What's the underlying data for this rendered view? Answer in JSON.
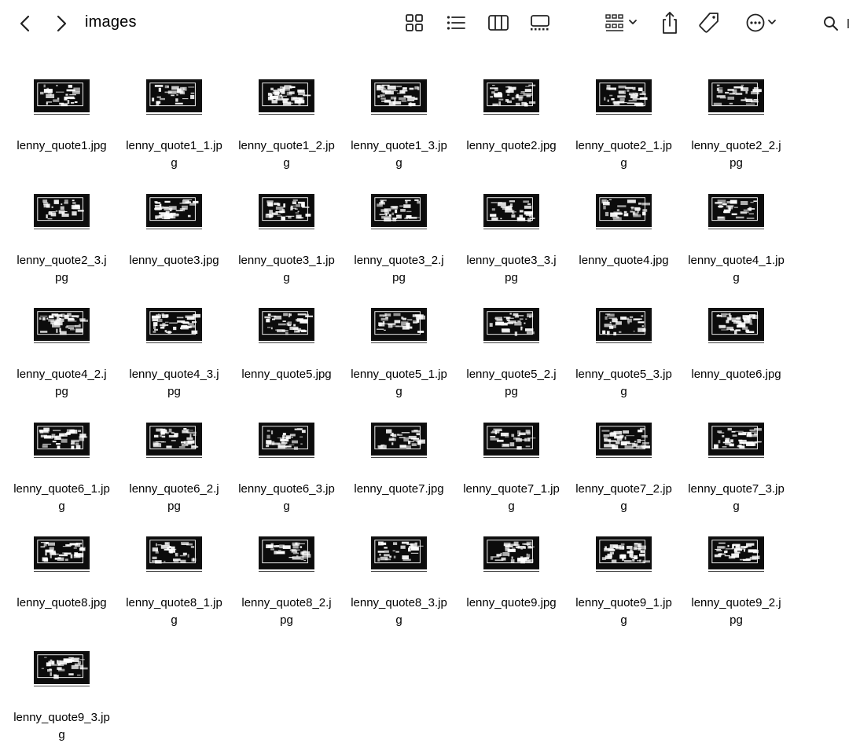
{
  "window": {
    "title": "images"
  },
  "toolbar": {
    "back_icon": "chevron-left-icon",
    "forward_icon": "chevron-right-icon",
    "view_modes": [
      "icon-view-icon",
      "list-view-icon",
      "column-view-icon",
      "gallery-view-icon"
    ],
    "group_icon": "group-by-icon",
    "share_icon": "share-icon",
    "tag_icon": "tag-icon",
    "action_icon": "more-actions-icon",
    "search_icon": "search-icon"
  },
  "files": [
    {
      "line1": "lenny_quote1.jpg",
      "line2": ""
    },
    {
      "line1": "lenny_quote1_1.jp",
      "line2": "g"
    },
    {
      "line1": "lenny_quote1_2.jp",
      "line2": "g"
    },
    {
      "line1": "lenny_quote1_3.jp",
      "line2": "g"
    },
    {
      "line1": "lenny_quote2.jpg",
      "line2": ""
    },
    {
      "line1": "lenny_quote2_1.jp",
      "line2": "g"
    },
    {
      "line1": "lenny_quote2_2.j",
      "line2": "pg"
    },
    {
      "line1": "lenny_quote2_3.j",
      "line2": "pg"
    },
    {
      "line1": "lenny_quote3.jpg",
      "line2": ""
    },
    {
      "line1": "lenny_quote3_1.jp",
      "line2": "g"
    },
    {
      "line1": "lenny_quote3_2.j",
      "line2": "pg"
    },
    {
      "line1": "lenny_quote3_3.j",
      "line2": "pg"
    },
    {
      "line1": "lenny_quote4.jpg",
      "line2": ""
    },
    {
      "line1": "lenny_quote4_1.jp",
      "line2": "g"
    },
    {
      "line1": "lenny_quote4_2.j",
      "line2": "pg"
    },
    {
      "line1": "lenny_quote4_3.j",
      "line2": "pg"
    },
    {
      "line1": "lenny_quote5.jpg",
      "line2": ""
    },
    {
      "line1": "lenny_quote5_1.jp",
      "line2": "g"
    },
    {
      "line1": "lenny_quote5_2.j",
      "line2": "pg"
    },
    {
      "line1": "lenny_quote5_3.jp",
      "line2": "g"
    },
    {
      "line1": "lenny_quote6.jpg",
      "line2": ""
    },
    {
      "line1": "lenny_quote6_1.jp",
      "line2": "g"
    },
    {
      "line1": "lenny_quote6_2.j",
      "line2": "pg"
    },
    {
      "line1": "lenny_quote6_3.jp",
      "line2": "g"
    },
    {
      "line1": "lenny_quote7.jpg",
      "line2": ""
    },
    {
      "line1": "lenny_quote7_1.jp",
      "line2": "g"
    },
    {
      "line1": "lenny_quote7_2.jp",
      "line2": "g"
    },
    {
      "line1": "lenny_quote7_3.jp",
      "line2": "g"
    },
    {
      "line1": "lenny_quote8.jpg",
      "line2": ""
    },
    {
      "line1": "lenny_quote8_1.jp",
      "line2": "g"
    },
    {
      "line1": "lenny_quote8_2.j",
      "line2": "pg"
    },
    {
      "line1": "lenny_quote8_3.jp",
      "line2": "g"
    },
    {
      "line1": "lenny_quote9.jpg",
      "line2": ""
    },
    {
      "line1": "lenny_quote9_1.jp",
      "line2": "g"
    },
    {
      "line1": "lenny_quote9_2.j",
      "line2": "pg"
    },
    {
      "line1": "lenny_quote9_3.jp",
      "line2": "g"
    }
  ],
  "thumbnails": {
    "style": "black-and-white",
    "background": "#0c0c0c",
    "foreground": "#ffffff"
  }
}
